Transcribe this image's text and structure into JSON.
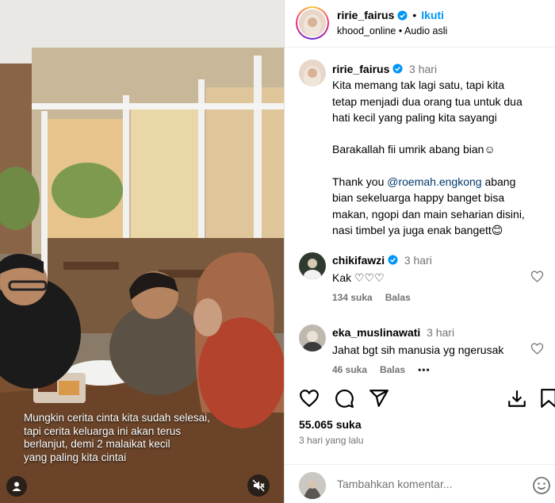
{
  "post": {
    "author": "ririe_fairus",
    "follow_label": "Ikuti",
    "separator": "•",
    "location": "khood_online",
    "audio": "Audio asli",
    "caption": {
      "time": "3 hari",
      "lines": [
        "Kita memang tak lagi satu, tapi kita",
        "tetap menjadi dua orang tua untuk dua",
        "hati kecil yang paling kita sayangi"
      ],
      "line2": "Barakallah fii umrik abang bian☺",
      "thanks_prefix": "Thank you ",
      "mention": "@roemah.engkong",
      "thanks_suffix": " abang",
      "thanks_lines": [
        "bian sekeluarga happy banget bisa",
        "makan, ngopi dan main seharian disini,",
        "nasi timbel ya juga enak bangett😊"
      ]
    },
    "comments": [
      {
        "user": "chikifawzi",
        "time": "3 hari",
        "text": "Kak ♡♡♡",
        "likes": "134 suka",
        "reply": "Balas"
      },
      {
        "user": "eka_muslinawati",
        "time": "3 hari",
        "text": "Jahat bgt sih manusia yg ngerusak",
        "likes": "46 suka",
        "reply": "Balas",
        "more": "•••"
      }
    ],
    "like_count": "55.065 suka",
    "posted": "3 hari yang lalu",
    "add_comment_placeholder": "Tambahkan komentar...",
    "video_caption": [
      "Mungkin cerita cinta kita sudah selesai,",
      "tapi cerita keluarga ini akan terus",
      "berlanjut, demi 2 malaikat kecil",
      "yang paling kita cintai"
    ]
  },
  "colors": {
    "accent": "#0095f6",
    "mention": "#00376b",
    "muted": "#737373",
    "verified": "#0095f6"
  },
  "icons": [
    "heart-icon",
    "comment-icon",
    "share-icon",
    "save-icon",
    "bookmark-icon",
    "mute-icon",
    "emoji-icon",
    "verified-icon"
  ]
}
